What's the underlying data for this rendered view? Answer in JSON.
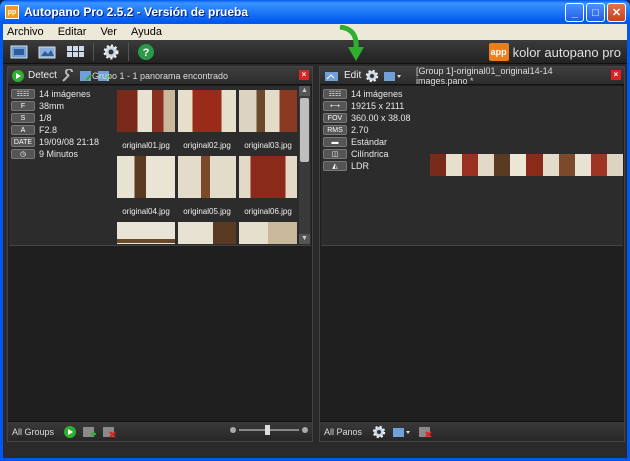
{
  "window": {
    "title": "Autopano Pro 2.5.2 - Versión de prueba",
    "app_icon_text": "pp"
  },
  "menubar": {
    "items": [
      "Archivo",
      "Editar",
      "Ver",
      "Ayuda"
    ]
  },
  "toolbar": {
    "brand_logo": "app",
    "brand_text": "kolor autopano pro"
  },
  "left_panel": {
    "detect_label": "Detect",
    "title": "Grupo 1 - 1 panorama encontrado",
    "info": [
      {
        "badge": "☷☷",
        "value": "14 imágenes"
      },
      {
        "badge": "F",
        "value": "38mm"
      },
      {
        "badge": "S",
        "value": "1/8"
      },
      {
        "badge": "A",
        "value": "F2.8"
      },
      {
        "badge": "DATE",
        "value": "19/09/08 21:18"
      },
      {
        "badge": "◷",
        "value": "9 Minutos"
      }
    ],
    "thumbnails": [
      {
        "name": "original01.jpg"
      },
      {
        "name": "original02.jpg"
      },
      {
        "name": "original03.jpg"
      },
      {
        "name": "original04.jpg"
      },
      {
        "name": "original05.jpg"
      },
      {
        "name": "original06.jpg"
      },
      {
        "name": ""
      },
      {
        "name": ""
      },
      {
        "name": ""
      }
    ],
    "footer_label": "All Groups"
  },
  "right_panel": {
    "edit_label": "Edit",
    "title": "[Group 1]-original01_original14-14 images.pano *",
    "info": [
      {
        "badge": "☷☷",
        "value": "14 imágenes"
      },
      {
        "badge": "⟷",
        "value": "19215 x 2111"
      },
      {
        "badge": "FOV",
        "value": "360.00 x 38.08"
      },
      {
        "badge": "RMS",
        "value": "2.70"
      },
      {
        "badge": "▬",
        "value": "Estándar"
      },
      {
        "badge": "◫",
        "value": "Cilíndrica"
      },
      {
        "badge": "◭",
        "value": "LDR"
      }
    ],
    "footer_label": "All Panos"
  },
  "colors": {
    "accent_green": "#2fae2f",
    "close_red": "#dd2222",
    "brand_orange": "#f07d1a"
  }
}
